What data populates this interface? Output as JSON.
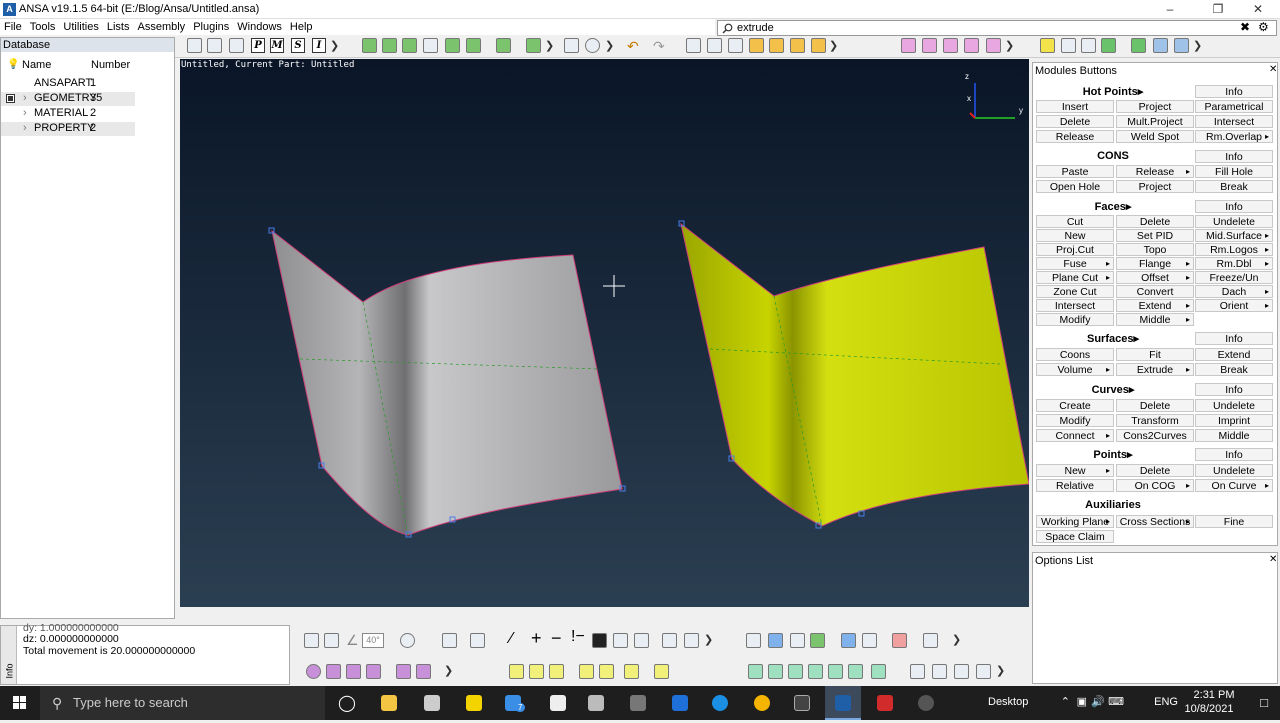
{
  "window": {
    "title": "ANSA v19.1.5 64-bit (E:/Blog/Ansa/Untitled.ansa)"
  },
  "menu": [
    "File",
    "Tools",
    "Utilities",
    "Lists",
    "Assembly",
    "Plugins",
    "Windows",
    "Help"
  ],
  "search": {
    "value": "extrude"
  },
  "database": {
    "title": "Database",
    "col_name": "Name",
    "col_number": "Number",
    "rows": [
      {
        "name": "ANSAPART",
        "number": "1"
      },
      {
        "name": "GEOMETRY",
        "number": "35"
      },
      {
        "name": "MATERIAL",
        "number": "2"
      },
      {
        "name": "PROPERTY",
        "number": "2"
      }
    ]
  },
  "viewport": {
    "label": "Untitled,  Current Part: Untitled",
    "axes": {
      "z": "z",
      "x": "x",
      "y": "y"
    }
  },
  "toolbar_letters": [
    "P",
    "M",
    "S",
    "I"
  ],
  "modules": {
    "title": "Modules Buttons",
    "hotpoints": {
      "title": "Hot Points",
      "buttons": [
        "Info",
        "Insert",
        "Project",
        "Parametrical",
        "Delete",
        "Mult.Project",
        "Intersect",
        "Release",
        "Weld Spot",
        "Rm.Overlap"
      ]
    },
    "cons": {
      "title": "CONS",
      "buttons": [
        "Info",
        "Paste",
        "Release",
        "Fill Hole",
        "Open Hole",
        "Project",
        "Break"
      ]
    },
    "faces": {
      "title": "Faces",
      "buttons": [
        "Info",
        "Cut",
        "Delete",
        "Undelete",
        "New",
        "Set PID",
        "Mid.Surface",
        "Proj.Cut",
        "Topo",
        "Rm.Logos",
        "Fuse",
        "Flange",
        "Rm.Dbl",
        "Plane Cut",
        "Offset",
        "Freeze/Un",
        "Zone Cut",
        "Convert",
        "Dach",
        "Intersect",
        "Extend",
        "Orient",
        "Modify",
        "Middle"
      ]
    },
    "surfaces": {
      "title": "Surfaces",
      "buttons": [
        "Info",
        "Coons",
        "Fit",
        "Extend",
        "Volume",
        "Extrude",
        "Break"
      ]
    },
    "curves": {
      "title": "Curves",
      "buttons": [
        "Info",
        "Create",
        "Delete",
        "Undelete",
        "Modify",
        "Transform",
        "Imprint",
        "Connect",
        "Cons2Curves",
        "Middle"
      ]
    },
    "points": {
      "title": "Points",
      "buttons": [
        "Info",
        "New",
        "Delete",
        "Undelete",
        "Relative",
        "On COG",
        "On Curve"
      ]
    },
    "aux": {
      "title": "Auxiliaries",
      "buttons": [
        "Working Plane",
        "Cross Sections",
        "Fine",
        "Space Claim"
      ]
    }
  },
  "options": {
    "title": "Options List"
  },
  "messages": {
    "lines": [
      "dy: 1.000000000000",
      "dz: 0.000000000000",
      "Total movement is 20.000000000000"
    ],
    "side": "Info"
  },
  "taskbar": {
    "search": "Type here to search",
    "desktop": "Desktop",
    "lang": "ENG",
    "time": "2:31 PM",
    "date": "10/8/2021",
    "badge": "7"
  },
  "colors": {
    "accent": "#1f5fa8",
    "yellow_part": "#c8d400",
    "grey_part": "#a8a8aa"
  }
}
